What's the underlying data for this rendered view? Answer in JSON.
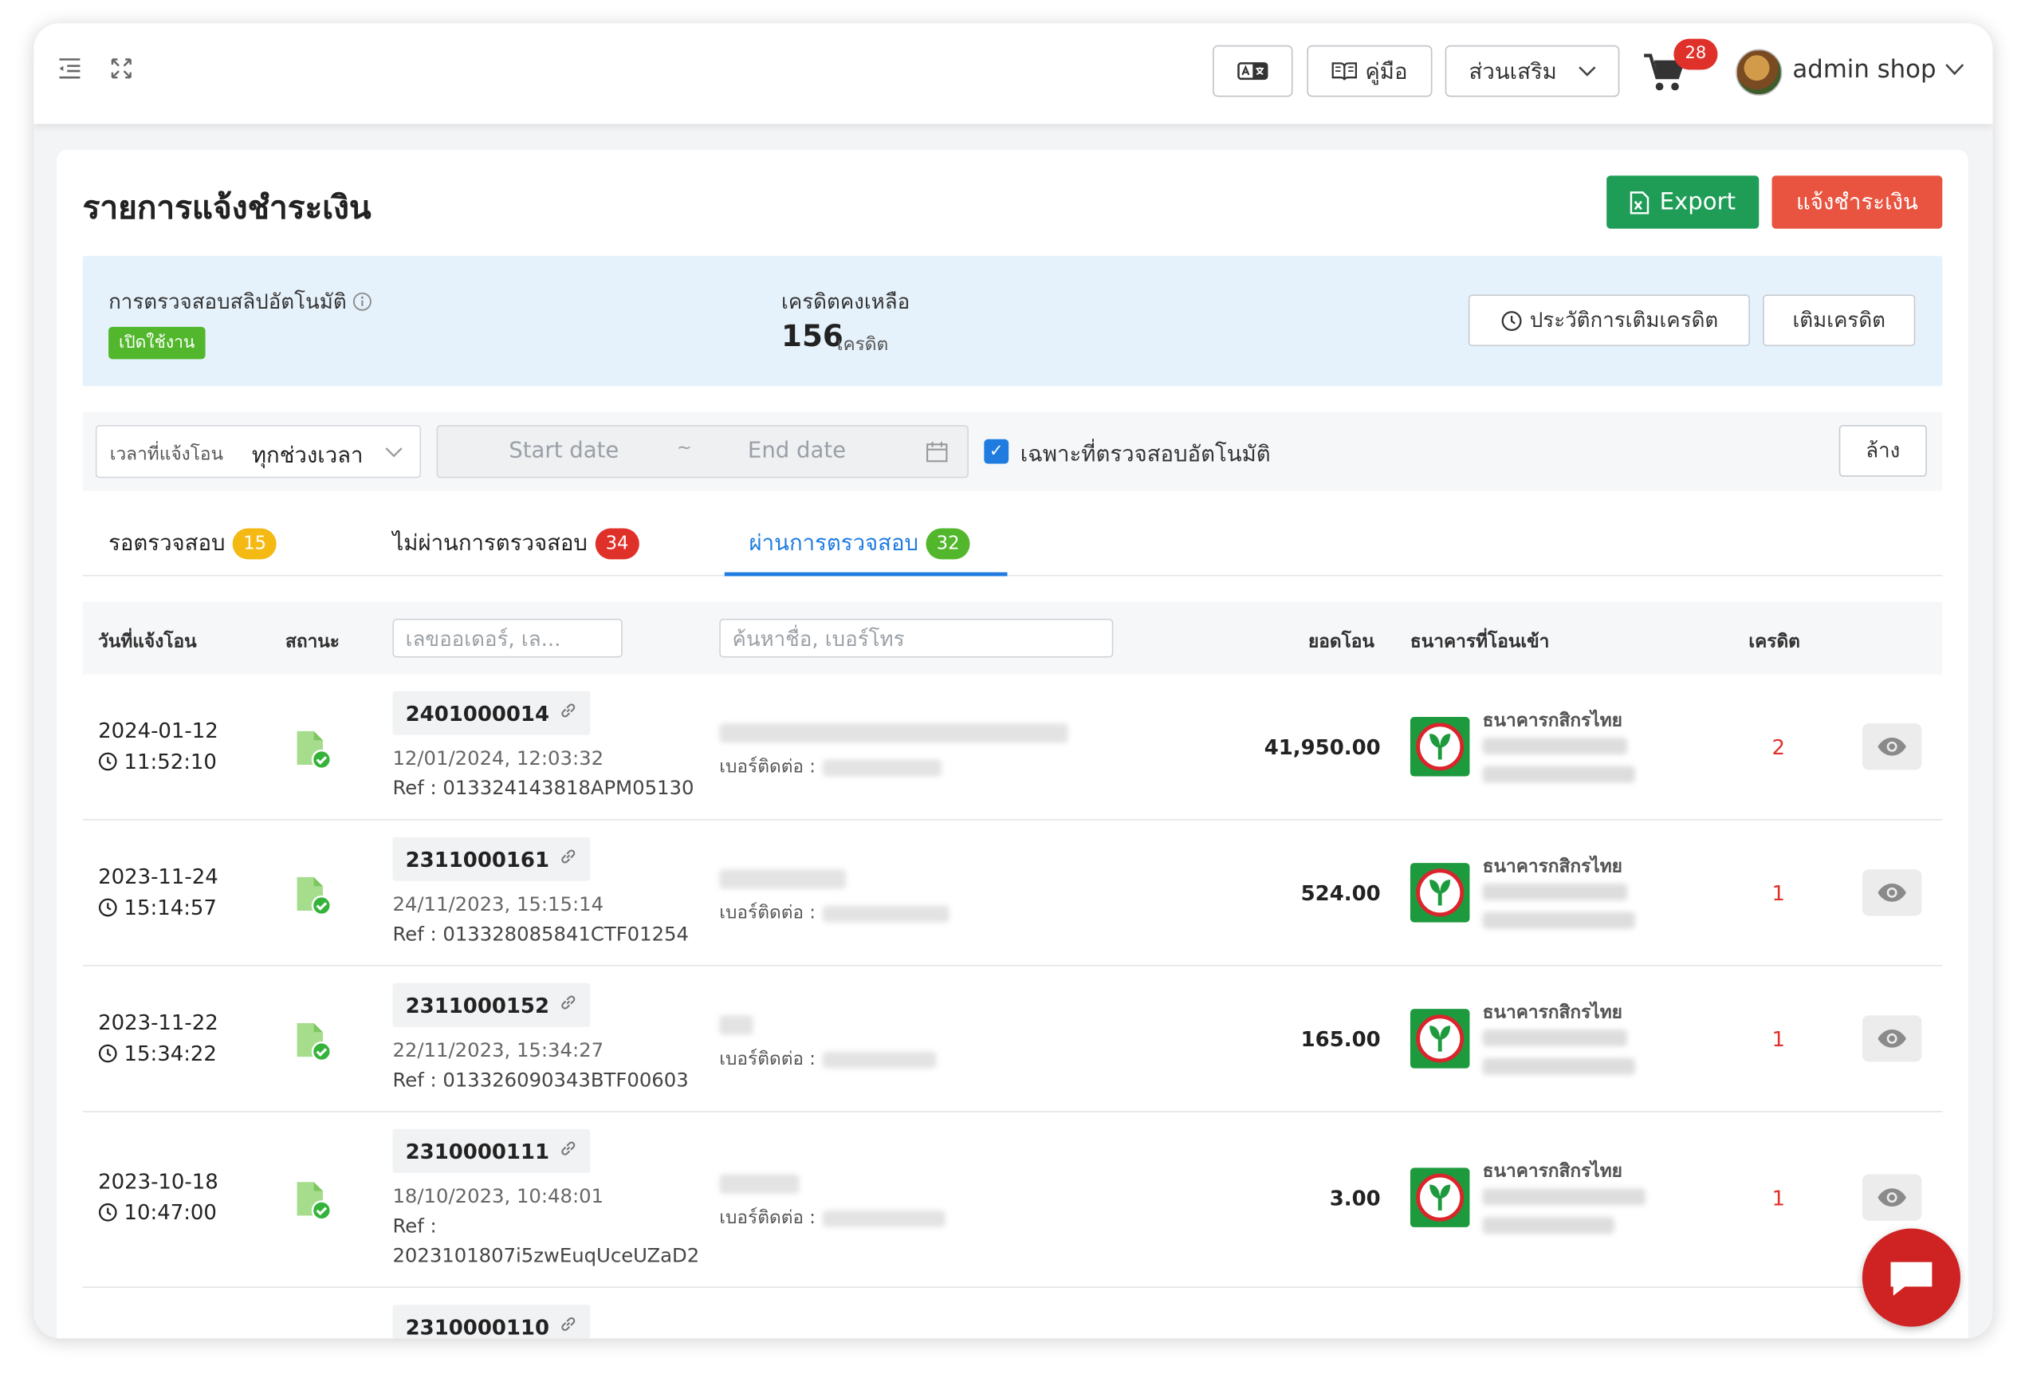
{
  "topbar": {
    "manual_label": "คู่มือ",
    "addons_label": "ส่วนเสริม",
    "cart_count": "28",
    "user_name": "admin shop"
  },
  "page": {
    "title": "รายการแจ้งชำระเงิน",
    "export_label": "Export",
    "notify_label": "แจ้งชำระเงิน"
  },
  "info": {
    "auto_check_label": "การตรวจสอบสลิปอัตโนมัติ",
    "auto_check_status": "เปิดใช้งาน",
    "credit_label": "เครดิตคงเหลือ",
    "credit_value": "156",
    "credit_unit": "เครดิต",
    "history_label": "ประวัติการเติมเครดิต",
    "topup_label": "เติมเครดิต"
  },
  "filter": {
    "time_label": "เวลาที่แจ้งโอน",
    "time_value": "ทุกช่วงเวลา",
    "start_placeholder": "Start date",
    "range_sep": "~",
    "end_placeholder": "End date",
    "auto_only_label": "เฉพาะที่ตรวจสอบอัตโนมัติ",
    "auto_only_checked": true,
    "clear_label": "ล้าง"
  },
  "tabs": [
    {
      "label": "รอตรวจสอบ",
      "count": "15",
      "color": "#f5b914"
    },
    {
      "label": "ไม่ผ่านการตรวจสอบ",
      "count": "34",
      "color": "#e0302a"
    },
    {
      "label": "ผ่านการตรวจสอบ",
      "count": "32",
      "color": "#52b72c",
      "active": true
    }
  ],
  "table": {
    "columns": {
      "date": "วันที่แจ้งโอน",
      "status": "สถานะ",
      "order_placeholder": "เลขออเดอร์, เล...",
      "search_placeholder": "ค้นหาชื่อ, เบอร์โทร",
      "amount": "ยอดโอน",
      "bank": "ธนาคารที่โอนเข้า",
      "credit": "เครดิต"
    },
    "contact_label": "เบอร์ติดต่อ :",
    "rows": [
      {
        "date": "2024-01-12",
        "time": "11:52:10",
        "order": "2401000014",
        "paid_at": "12/01/2024, 12:03:32",
        "ref": "Ref : 013324143818APM05130",
        "amount": "41,950.00",
        "bank": "ธนาคารกสิกรไทย",
        "credit": "2"
      },
      {
        "date": "2023-11-24",
        "time": "15:14:57",
        "order": "2311000161",
        "paid_at": "24/11/2023, 15:15:14",
        "ref": "Ref : 013328085841CTF01254",
        "amount": "524.00",
        "bank": "ธนาคารกสิกรไทย",
        "credit": "1"
      },
      {
        "date": "2023-11-22",
        "time": "15:34:22",
        "order": "2311000152",
        "paid_at": "22/11/2023, 15:34:27",
        "ref": "Ref : 013326090343BTF00603",
        "amount": "165.00",
        "bank": "ธนาคารกสิกรไทย",
        "credit": "1"
      },
      {
        "date": "2023-10-18",
        "time": "10:47:00",
        "order": "2310000111",
        "paid_at": "18/10/2023, 10:48:01",
        "ref": "Ref :",
        "ref2": "2023101807i5zwEuqUceUZaD2",
        "amount": "3.00",
        "bank": "ธนาคารกสิกรไทย",
        "credit": "1"
      },
      {
        "order": "2310000110"
      }
    ]
  }
}
